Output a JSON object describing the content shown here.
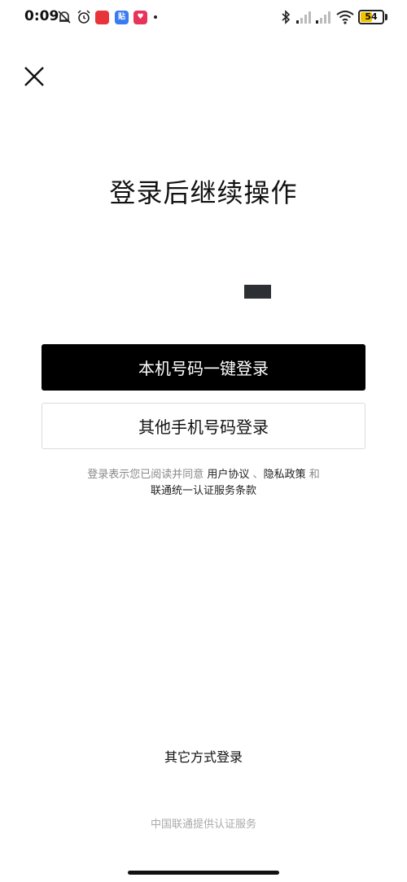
{
  "status_bar": {
    "time": "0:09",
    "app_badge_1": "",
    "app_badge_2": "贴",
    "battery": "54",
    "battery_level": 0.54
  },
  "title": "登录后继续操作",
  "buttons": {
    "one_key_login": "本机号码一键登录",
    "other_phone_login": "其他手机号码登录"
  },
  "agreement": {
    "prefix": "登录表示您已阅读并同意 ",
    "user_agreement": "用户协议",
    "sep": " 、",
    "privacy_policy": "隐私政策",
    "and": " 和",
    "unicom_terms": "联通统一认证服务条款"
  },
  "other_methods": "其它方式登录",
  "footer": "中国联通提供认证服务"
}
